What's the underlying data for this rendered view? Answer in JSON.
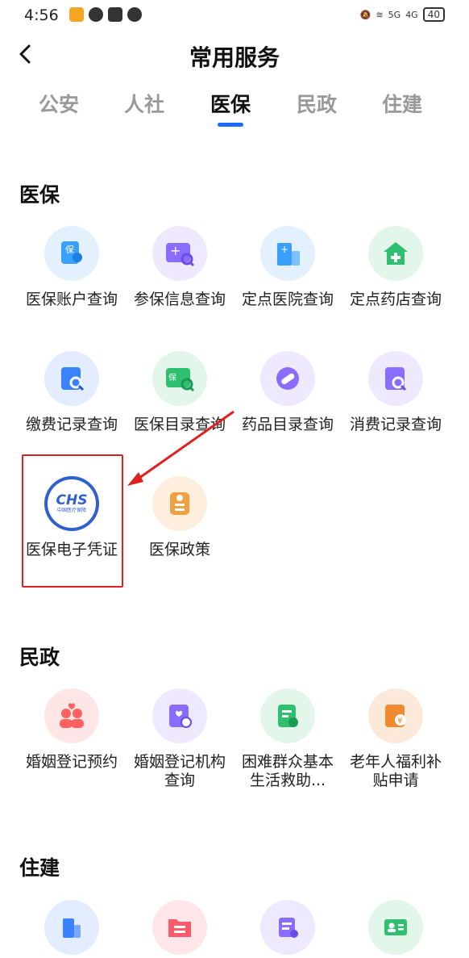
{
  "status_bar": {
    "time": "4:56",
    "battery": "40",
    "net1": "5G",
    "net2": "4G"
  },
  "header": {
    "title": "常用服务"
  },
  "tabs": [
    "公安",
    "人社",
    "医保",
    "民政",
    "住建"
  ],
  "active_tab": "医保",
  "sections": {
    "yibao": {
      "title": "医保",
      "items": [
        {
          "label": "医保账户查询",
          "icon": "insurance-account-icon",
          "color": "#3aa0ff"
        },
        {
          "label": "参保信息查询",
          "icon": "insurance-info-icon",
          "color": "#8a6cff"
        },
        {
          "label": "定点医院查询",
          "icon": "hospital-icon",
          "color": "#3aa0ff"
        },
        {
          "label": "定点药店查询",
          "icon": "pharmacy-icon",
          "color": "#2fbf71"
        },
        {
          "label": "缴费记录查询",
          "icon": "payment-record-icon",
          "color": "#3a82ff"
        },
        {
          "label": "医保目录查询",
          "icon": "catalog-icon",
          "color": "#2fbf71"
        },
        {
          "label": "药品目录查询",
          "icon": "medicine-icon",
          "color": "#8a6cff"
        },
        {
          "label": "消费记录查询",
          "icon": "consumption-record-icon",
          "color": "#8a6cff"
        },
        {
          "label": "医保电子凭证",
          "icon": "chs-logo-icon",
          "color": "#2f5fd0",
          "logo_text": "CHS",
          "logo_sub": "中国医疗保障"
        },
        {
          "label": "医保政策",
          "icon": "policy-icon",
          "color": "#f0a040"
        }
      ]
    },
    "minzheng": {
      "title": "民政",
      "items": [
        {
          "label": "婚姻登记预约",
          "icon": "marriage-icon",
          "color": "#ff6060"
        },
        {
          "label": "婚姻登记机构查询",
          "icon": "marriage-org-icon",
          "color": "#8a6cff"
        },
        {
          "label": "困难群众基本生活救助...",
          "icon": "relief-icon",
          "color": "#2fbf71"
        },
        {
          "label": "老年人福利补贴申请",
          "icon": "elderly-icon",
          "color": "#f08a30"
        }
      ]
    },
    "zhujian": {
      "title": "住建",
      "items": [
        {
          "label": "",
          "icon": "building-icon",
          "color": "#3a82ff"
        },
        {
          "label": "",
          "icon": "folder-icon",
          "color": "#ff5a6a"
        },
        {
          "label": "",
          "icon": "document-icon",
          "color": "#8a6cff"
        },
        {
          "label": "",
          "icon": "id-card-icon",
          "color": "#2fbf71"
        }
      ]
    }
  }
}
